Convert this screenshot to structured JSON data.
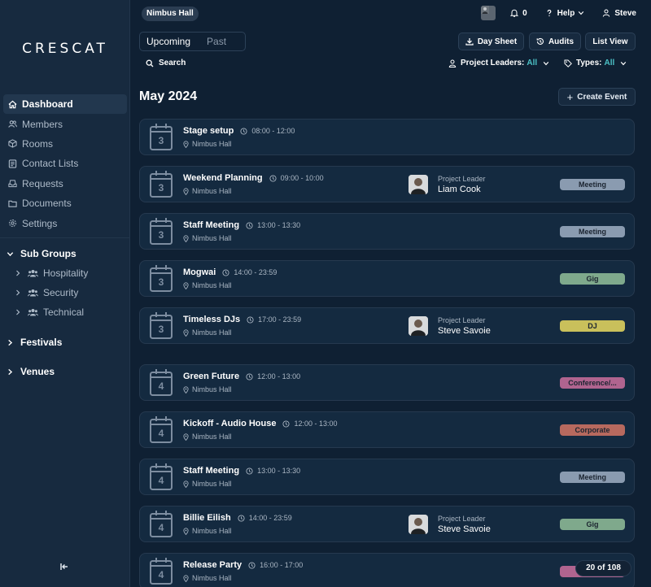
{
  "app": {
    "logo": "CRESCAT",
    "venue": "Nimbus Hall"
  },
  "sidebar": {
    "items": [
      {
        "label": "Dashboard",
        "icon": "home-icon",
        "active": true
      },
      {
        "label": "Members",
        "icon": "members-icon"
      },
      {
        "label": "Rooms",
        "icon": "rooms-icon"
      },
      {
        "label": "Contact Lists",
        "icon": "contact-lists-icon"
      },
      {
        "label": "Requests",
        "icon": "requests-icon"
      },
      {
        "label": "Documents",
        "icon": "folder-icon"
      },
      {
        "label": "Settings",
        "icon": "gear-icon"
      }
    ],
    "sub_groups": {
      "label": "Sub Groups",
      "items": [
        {
          "label": "Hospitality"
        },
        {
          "label": "Security"
        },
        {
          "label": "Technical"
        }
      ]
    },
    "festivals": "Festivals",
    "venues": "Venues"
  },
  "header": {
    "notifications": "0",
    "help": "Help",
    "user": "Steve"
  },
  "toolbar": {
    "tab_upcoming": "Upcoming",
    "tab_past": "Past",
    "day_sheet": "Day Sheet",
    "audits": "Audits",
    "list_view": "List View",
    "search": "Search",
    "project_leaders": "Project Leaders:",
    "project_leaders_value": "All",
    "types": "Types:",
    "types_value": "All"
  },
  "month": "May 2024",
  "create_event": "Create Event",
  "events": [
    {
      "day": "3",
      "title": "Stage setup",
      "time": "08:00 - 12:00",
      "location": "Nimbus Hall"
    },
    {
      "day": "3",
      "title": "Weekend Planning",
      "time": "09:00 - 10:00",
      "location": "Nimbus Hall",
      "leader_label": "Project Leader",
      "leader": "Liam Cook",
      "tag": "Meeting",
      "tag_color": "#8a9bb0"
    },
    {
      "day": "3",
      "title": "Staff Meeting",
      "time": "13:00 - 13:30",
      "location": "Nimbus Hall",
      "tag": "Meeting",
      "tag_color": "#8a9bb0"
    },
    {
      "day": "3",
      "title": "Mogwai",
      "time": "14:00 - 23:59",
      "location": "Nimbus Hall",
      "tag": "Gig",
      "tag_color": "#7fa98c"
    },
    {
      "day": "3",
      "title": "Timeless DJs",
      "time": "17:00 - 23:59",
      "location": "Nimbus Hall",
      "leader_label": "Project Leader",
      "leader": "Steve Savoie",
      "tag": "DJ",
      "tag_color": "#c9c05b"
    },
    {
      "day": "4",
      "title": "Green Future",
      "time": "12:00 - 13:00",
      "location": "Nimbus Hall",
      "tag": "Conference/...",
      "tag_color": "#b0648f"
    },
    {
      "day": "4",
      "title": "Kickoff - Audio House",
      "time": "12:00 - 13:00",
      "location": "Nimbus Hall",
      "tag": "Corporate",
      "tag_color": "#b7695e"
    },
    {
      "day": "4",
      "title": "Staff Meeting",
      "time": "13:00 - 13:30",
      "location": "Nimbus Hall",
      "tag": "Meeting",
      "tag_color": "#8a9bb0"
    },
    {
      "day": "4",
      "title": "Billie Eilish",
      "time": "14:00 - 23:59",
      "location": "Nimbus Hall",
      "leader_label": "Project Leader",
      "leader": "Steve Savoie",
      "tag": "Gig",
      "tag_color": "#7fa98c"
    },
    {
      "day": "4",
      "title": "Release Party",
      "time": "16:00 - 17:00",
      "location": "Nimbus Hall",
      "tag": "Co",
      "tag_color": "#b0648f"
    }
  ],
  "pagination": "20 of 108"
}
